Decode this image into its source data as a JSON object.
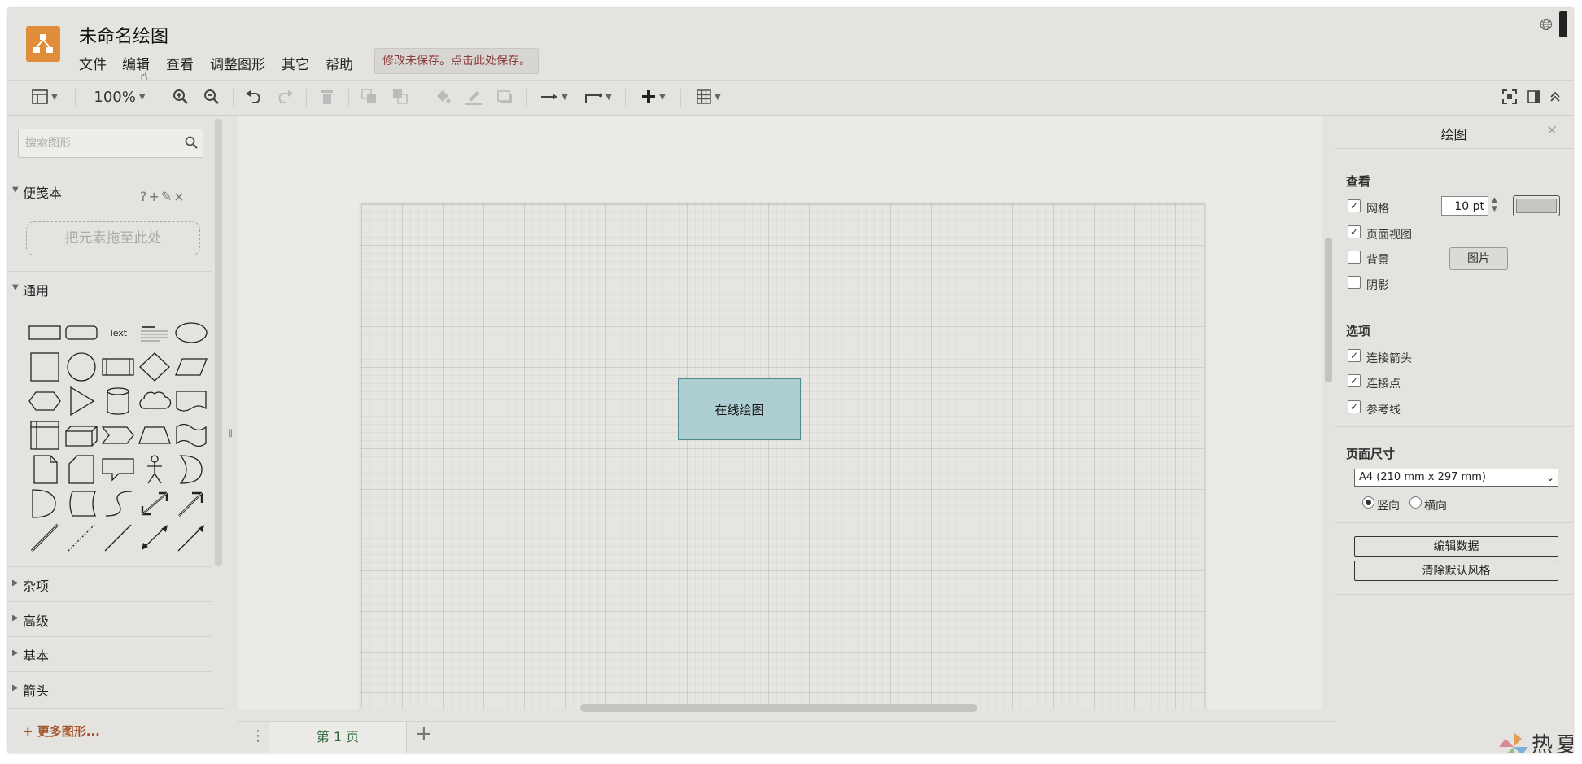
{
  "app": {
    "title": "未命名绘图",
    "save_notice": "修改未保存。点击此处保存。",
    "colors": {
      "logo": "#e08c3b",
      "node_fill": "#aecfd1",
      "node_stroke": "#4d8c90",
      "more_shapes": "#a4542a",
      "page_tab_text": "#2d6b3a"
    }
  },
  "menu": [
    "文件",
    "编辑",
    "查看",
    "调整图形",
    "其它",
    "帮助"
  ],
  "toolbar": {
    "zoom": "100%",
    "icons": [
      "layout-icon",
      "zoom-in-icon",
      "zoom-out-icon",
      "undo-icon",
      "redo-icon",
      "delete-icon",
      "to-front-icon",
      "to-back-icon",
      "fill-color-icon",
      "line-color-icon",
      "shadow-icon",
      "connection-icon",
      "waypoints-icon",
      "insert-icon",
      "table-icon",
      "fullscreen-icon",
      "format-panel-icon",
      "collapse-icon"
    ]
  },
  "sidebar": {
    "search_placeholder": "搜索图形",
    "scratchpad": {
      "label": "便笺本",
      "tools": "?+✎×",
      "drop_hint": "把元素拖至此处"
    },
    "general": {
      "label": "通用",
      "text_shape": "Text"
    },
    "sections": [
      "杂项",
      "高级",
      "基本",
      "箭头"
    ],
    "more_shapes": "+ 更多图形..."
  },
  "canvas": {
    "node_label": "在线绘图"
  },
  "page_tabs": {
    "menu": "⋮",
    "current": "第 1 页",
    "add": "+"
  },
  "panel": {
    "title": "绘图",
    "close": "×",
    "view": {
      "header": "查看",
      "grid": {
        "label": "网格",
        "checked": true,
        "size": "10 pt"
      },
      "page_view": {
        "label": "页面视图",
        "checked": true
      },
      "background": {
        "label": "背景",
        "checked": false,
        "image_button": "图片"
      },
      "shadow": {
        "label": "阴影",
        "checked": false
      }
    },
    "options": {
      "header": "选项",
      "connection_arrows": {
        "label": "连接箭头",
        "checked": true
      },
      "connection_points": {
        "label": "连接点",
        "checked": true
      },
      "guides": {
        "label": "参考线",
        "checked": true
      }
    },
    "page_size": {
      "header": "页面尺寸",
      "selected": "A4 (210 mm x 297 mm)",
      "portrait": "竖向",
      "landscape": "横向",
      "orientation": "portrait"
    },
    "edit_data": "编辑数据",
    "clear_default_style": "清除默认风格"
  },
  "watermark": "热夏"
}
